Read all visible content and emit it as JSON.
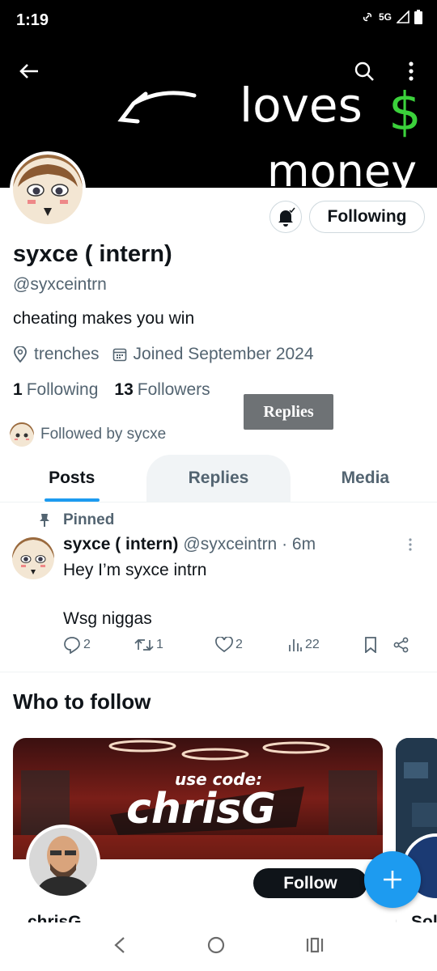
{
  "status_bar": {
    "time": "1:19",
    "network": "5G"
  },
  "banner": {
    "caption_line1": "loves",
    "caption_symbol": "$",
    "caption_line2": "money"
  },
  "profile": {
    "name": "syxce ( intern)",
    "handle": "@syxceintrn",
    "bio": "cheating makes you win",
    "location": "trenches",
    "joined": "Joined September 2024",
    "following_count": "1",
    "following_label": "Following",
    "followers_count": "13",
    "followers_label": "Followers",
    "followed_by": "Followed by sycxe",
    "following_button": "Following"
  },
  "tooltip": "Replies",
  "tabs": [
    "Posts",
    "Replies",
    "Media"
  ],
  "post": {
    "pinned_label": "Pinned",
    "author": "syxce ( intern)",
    "meta": "@syxceintrn · 6m",
    "text": "Hey I’m syxce intrn\n\nWsg niggas",
    "replies": "2",
    "reposts": "1",
    "likes": "2",
    "views": "22"
  },
  "who_to_follow": {
    "title": "Who to follow",
    "card_banner_small": "use code:",
    "card_banner_big": "chrisG",
    "card_name": "chrisG",
    "card2_name": "Sol",
    "follow_button": "Follow"
  },
  "colors": {
    "accent": "#1d9bf0",
    "text": "#0f1419",
    "muted": "#536471",
    "green": "#3bd13b"
  }
}
